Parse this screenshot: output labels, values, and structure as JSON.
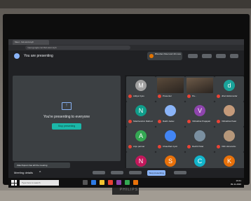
{
  "browser": {
    "tab_title": "Meet - fsd-wsmt-kyh",
    "url": "meet.google.com/fsd-wsmt-kyh"
  },
  "meet": {
    "presenting_banner": "You are presenting",
    "notice_text": "Bhushan Patel and 49 more",
    "stage_text": "You're presenting to everyone",
    "stop_button_label": "Stop presenting",
    "toast_text": "Zala Rupam has left the meeting",
    "meeting_details_label": "Meeting details",
    "present_button_label": "Stop presenting"
  },
  "participants": [
    {
      "initial": "M",
      "name": "Aditya Vyas",
      "color": "#a0a0a0",
      "video": false
    },
    {
      "initial": "",
      "name": "Presenter",
      "color": "#5a4a3a",
      "video": true
    },
    {
      "initial": "",
      "name": "Pa...",
      "color": "#6d5a48",
      "video": true
    },
    {
      "initial": "d",
      "name": "dharmikdamodar",
      "color": "#1aa39a",
      "video": false
    },
    {
      "initial": "N",
      "name": "Nilachandrar Rathod",
      "color": "#0f9d8a",
      "video": false
    },
    {
      "initial": "",
      "name": "Rakhi Jadav",
      "color": "#8ab4f8",
      "video": false
    },
    {
      "initial": "V",
      "name": "Vibhabhai Prajapati",
      "color": "#8e44ad",
      "video": false
    },
    {
      "initial": "",
      "name": "Vibhabhai Patel",
      "color": "#c49a7a",
      "video": false
    },
    {
      "initial": "A",
      "name": "Anju parmar",
      "color": "#34a853",
      "video": false
    },
    {
      "initial": "",
      "name": "Chaudhari Jyoti",
      "color": "#4285f4",
      "video": false
    },
    {
      "initial": "",
      "name": "Rachit Patel",
      "color": "#7a8fa0",
      "video": false
    },
    {
      "initial": "",
      "name": "Vibh Himanshu",
      "color": "#b5977a",
      "video": false
    },
    {
      "initial": "N",
      "name": "Narendra Karol",
      "color": "#c2185b",
      "video": false
    },
    {
      "initial": "S",
      "name": "Sanjay Bamaniya",
      "color": "#e8710a",
      "video": false
    },
    {
      "initial": "C",
      "name": "Chaudhary Khushal",
      "color": "#12b5cb",
      "video": false
    },
    {
      "initial": "K",
      "name": "Kiran Solanki",
      "color": "#e8710a",
      "video": false
    }
  ],
  "taskbar": {
    "search_placeholder": "Type here to search",
    "time": "10:41",
    "date": "09-11-2020"
  },
  "monitor": {
    "brand": "PHILIPS"
  }
}
